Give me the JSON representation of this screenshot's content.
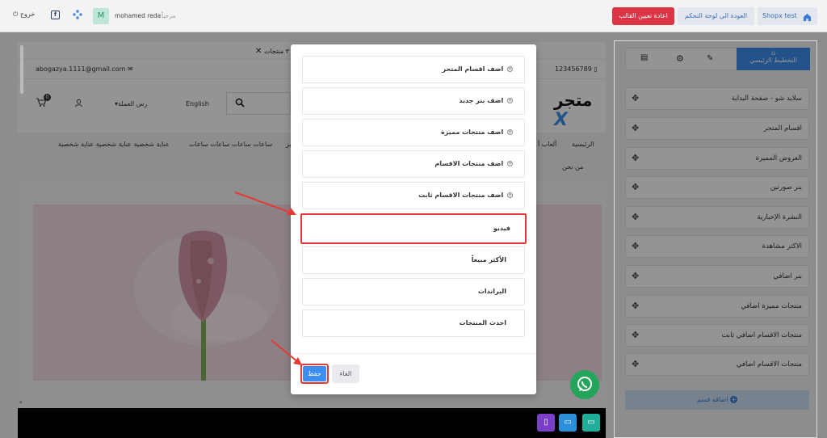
{
  "topbar": {
    "store_link": "Shopx test",
    "back_button": "العودة الي لوحة التحكم",
    "reset_button": "اعادة تعيين القالب",
    "logout": "خروج",
    "user_name": "mohamed reda",
    "welcome": "مرحباً",
    "avatar_letter": "M"
  },
  "preview": {
    "products_count_label": "٣ منتجات",
    "email": "abogazya.1111@gmail.com",
    "phone": "123456789",
    "logo_text": "متجر",
    "language": "English",
    "currency": "رس العملة",
    "cart_count": "0",
    "nav_items": [
      "الرئيسية",
      "ألعاب أ",
      "ساعات ساعات ساعات ساعات",
      "عناية شخصية عناية شخصية عناية شخصية"
    ],
    "nav_about": "من نحن",
    "nav_partial": "ير"
  },
  "right_panel": {
    "tab_main_layout": "التخطيط الرئيسي",
    "sections": [
      "سلايد شو - صفحة البداية",
      "اقسام المتجر",
      "العروض المميزة",
      "بنر صورتين",
      "النشرة الإخبارية",
      "الاكثر مشاهدة",
      "بنر اضافي",
      "منتجات مميزة اضافي",
      "منتجات الاقسام اضافي ثابت",
      "منتجات الاقسام اضافي"
    ],
    "add_section": "اضافه قسم"
  },
  "modal": {
    "options": [
      "اضف اقسام المتجر",
      "اضف بنر جديد",
      "اضف منتجات مميزة",
      "اضف منتجات الاقسام",
      "اضف منتجات الاقسام ثابت",
      "فيديو",
      "الأكثر مبيعاً",
      "البراندات",
      "احدث المنتجات"
    ],
    "save_button": "حفظ",
    "cancel_button": "الغاء"
  },
  "colors": {
    "primary": "#3d8ef0",
    "danger": "#dc3545",
    "highlight": "#e53935",
    "whatsapp": "#25a45c"
  },
  "icons": [
    "home-icon",
    "power-icon",
    "envelope-icon",
    "phone-icon",
    "search-icon",
    "cart-icon",
    "user-icon",
    "gear-icon",
    "brush-icon",
    "file-icon",
    "move-icon",
    "plus-circle-icon",
    "whatsapp-icon",
    "mobile-icon",
    "tablet-icon",
    "desktop-icon"
  ]
}
